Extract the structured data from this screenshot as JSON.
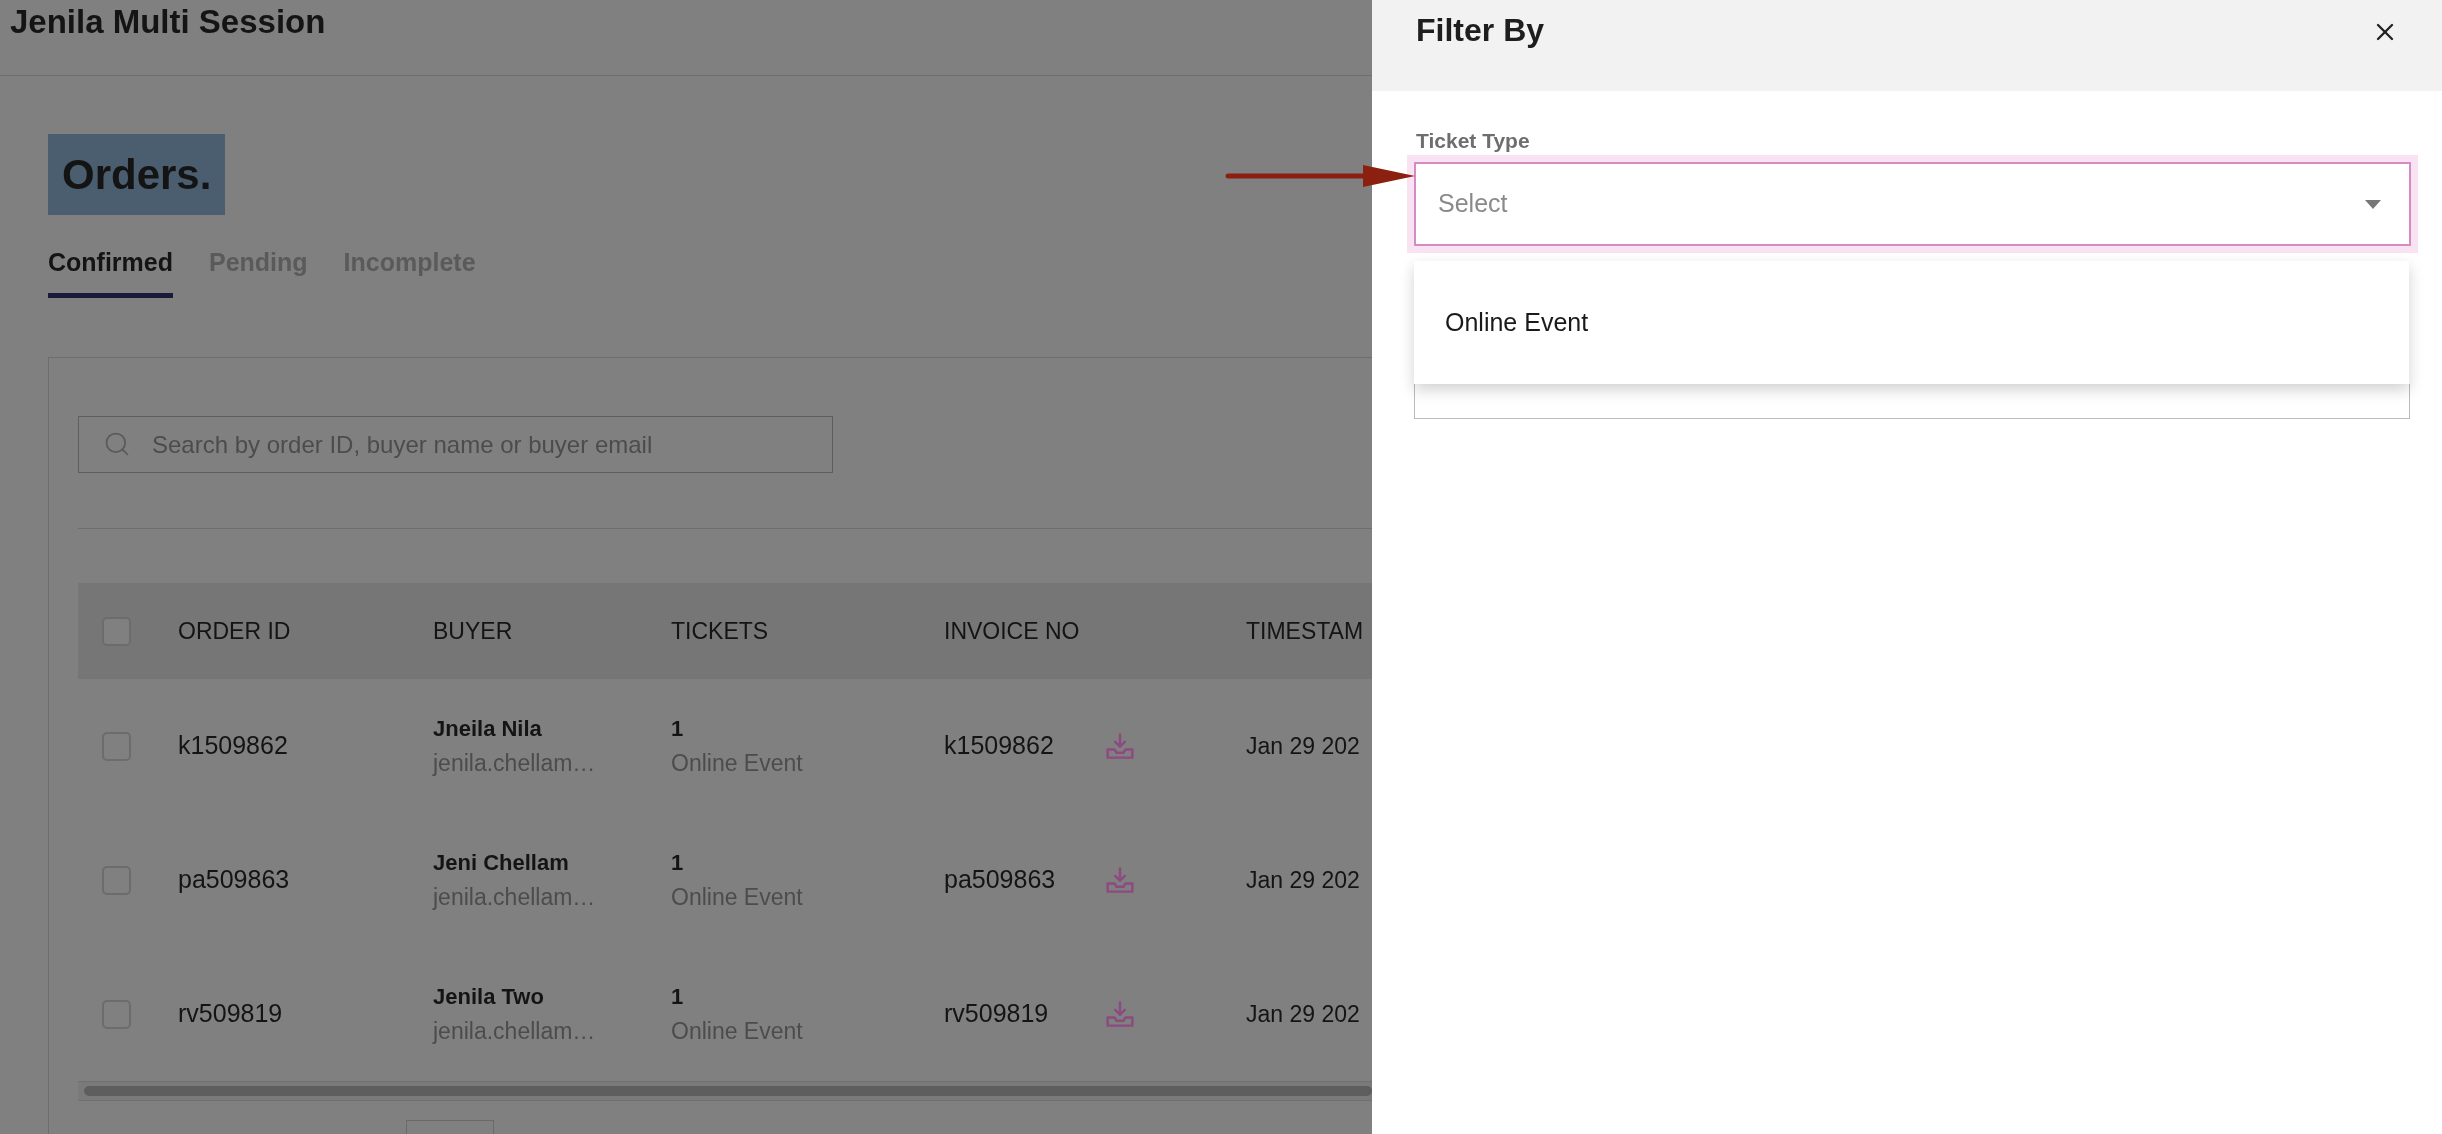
{
  "page": {
    "title": "Jenila Multi Session",
    "heading": {
      "text": "Orders.",
      "highlighted": true
    },
    "tabs": [
      {
        "label": "Confirmed",
        "selected": true
      },
      {
        "label": "Pending",
        "selected": false
      },
      {
        "label": "Incomplete",
        "selected": false
      }
    ],
    "search": {
      "placeholder": "Search by order ID, buyer name or buyer email"
    },
    "table": {
      "select_all_checked": false,
      "columns": [
        "ORDER ID",
        "BUYER",
        "TICKETS",
        "INVOICE NO",
        "TIMESTAM"
      ],
      "rows": [
        {
          "checked": false,
          "order_id": "k1509862",
          "buyer_name": "Jneila Nila",
          "buyer_email": "jenila.chellam…",
          "tickets": "1",
          "ticket_type": "Online Event",
          "invoice_no": "k1509862",
          "timestamp": "Jan 29 202"
        },
        {
          "checked": false,
          "order_id": "pa509863",
          "buyer_name": "Jeni Chellam",
          "buyer_email": "jenila.chellam…",
          "tickets": "1",
          "ticket_type": "Online Event",
          "invoice_no": "pa509863",
          "timestamp": "Jan 29 202"
        },
        {
          "checked": false,
          "order_id": "rv509819",
          "buyer_name": "Jenila Two",
          "buyer_email": "jenila.chellam…",
          "tickets": "1",
          "ticket_type": "Online Event",
          "invoice_no": "rv509819",
          "timestamp": "Jan 29 202"
        }
      ]
    }
  },
  "filter_panel": {
    "title": "Filter By",
    "fields": [
      {
        "label": "Ticket Type",
        "placeholder": "Select",
        "focused": true,
        "expanded": true,
        "options": [
          {
            "label": "Online Event",
            "selected": false
          }
        ]
      }
    ]
  }
}
